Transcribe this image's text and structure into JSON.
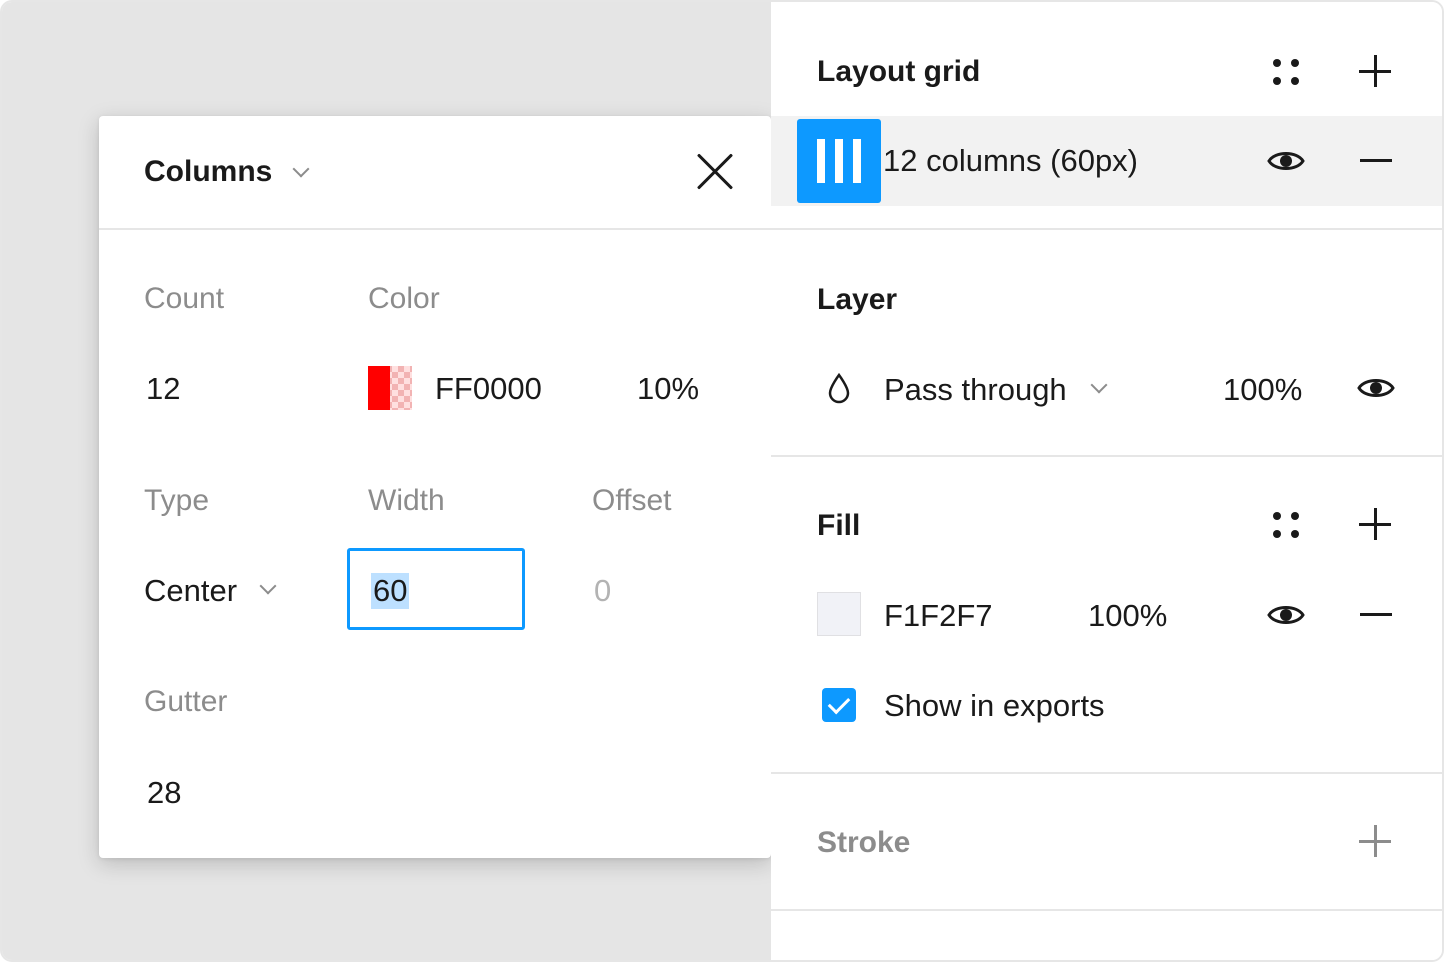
{
  "colors": {
    "accent": "#0D99FF",
    "column_color": "#FF0000",
    "fill_color": "#F1F2F7"
  },
  "popover": {
    "title": "Columns",
    "count": {
      "label": "Count",
      "value": "12"
    },
    "color": {
      "label": "Color",
      "hex": "FF0000",
      "opacity": "10%"
    },
    "type": {
      "label": "Type",
      "value": "Center"
    },
    "width": {
      "label": "Width",
      "value": "60"
    },
    "offset": {
      "label": "Offset",
      "value": "0"
    },
    "gutter": {
      "label": "Gutter",
      "value": "28"
    }
  },
  "panel": {
    "layout_grid": {
      "title": "Layout grid",
      "item_label": "12 columns (60px)"
    },
    "layer": {
      "title": "Layer",
      "blend_mode": "Pass through",
      "opacity": "100%"
    },
    "fill": {
      "title": "Fill",
      "hex": "F1F2F7",
      "opacity": "100%",
      "show_in_exports": "Show in exports",
      "show_in_exports_checked": true
    },
    "stroke": {
      "title": "Stroke"
    }
  }
}
